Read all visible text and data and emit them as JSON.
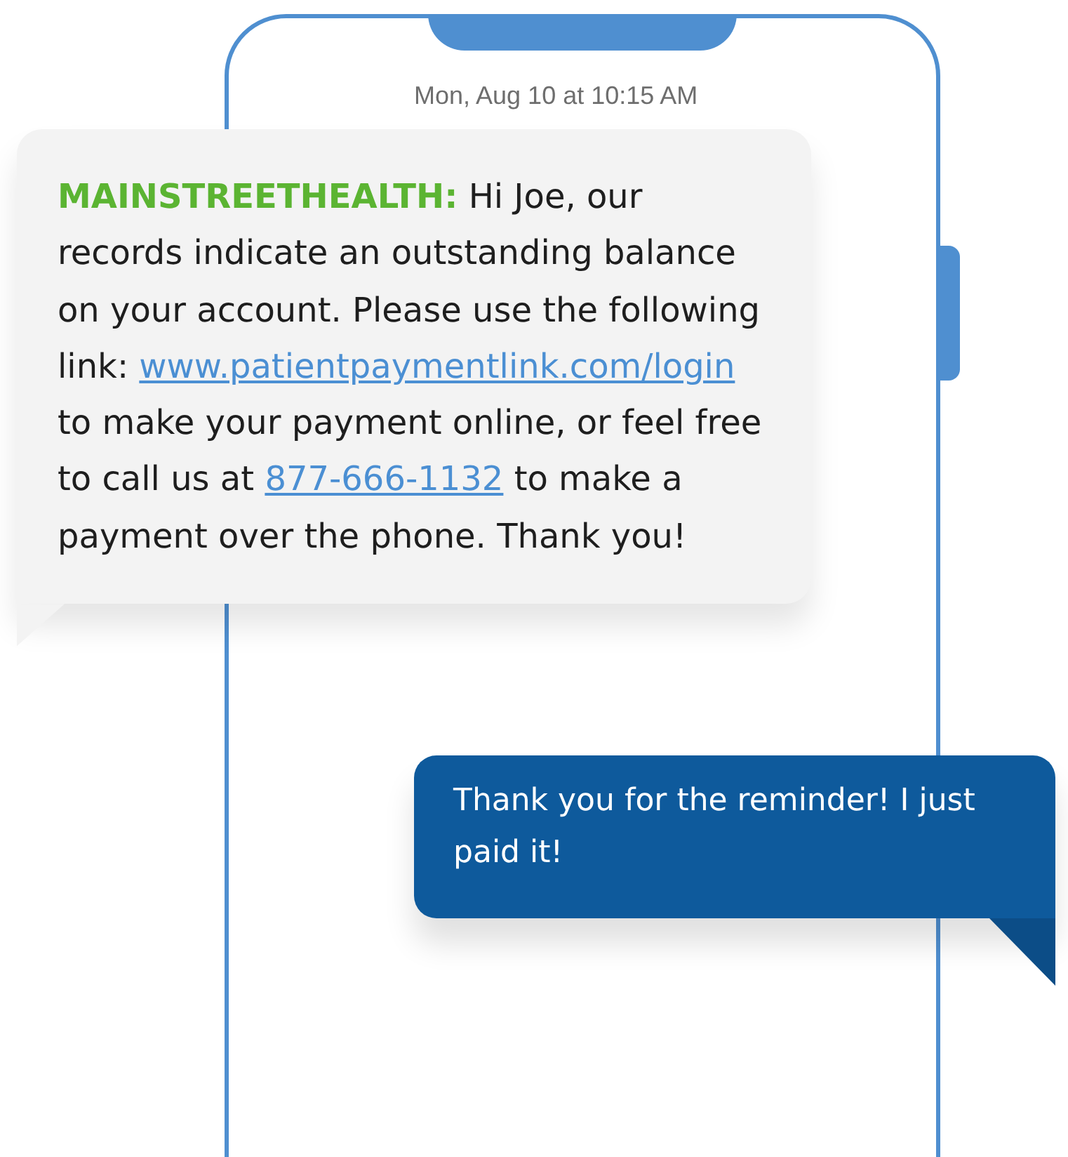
{
  "timestamp": "Mon, Aug 10 at 10:15 AM",
  "messages": [
    {
      "kind": "incoming",
      "sender": "MAINSTREETHEALTH:",
      "parts": [
        {
          "kind": "text",
          "text": " Hi Joe, our records indicate an outstanding balance on your account. Please use the following link: "
        },
        {
          "kind": "link",
          "text": "www.patientpaymentlink.com/login"
        },
        {
          "kind": "text",
          "text": " to make your payment online, or feel free to call us at "
        },
        {
          "kind": "link",
          "text": "877-666-1132"
        },
        {
          "kind": "text",
          "text": " to make a payment over the phone. Thank you!"
        }
      ]
    },
    {
      "kind": "outgoing",
      "parts": [
        {
          "kind": "text",
          "text": "Thank you for the reminder! I just paid it!"
        }
      ]
    }
  ]
}
